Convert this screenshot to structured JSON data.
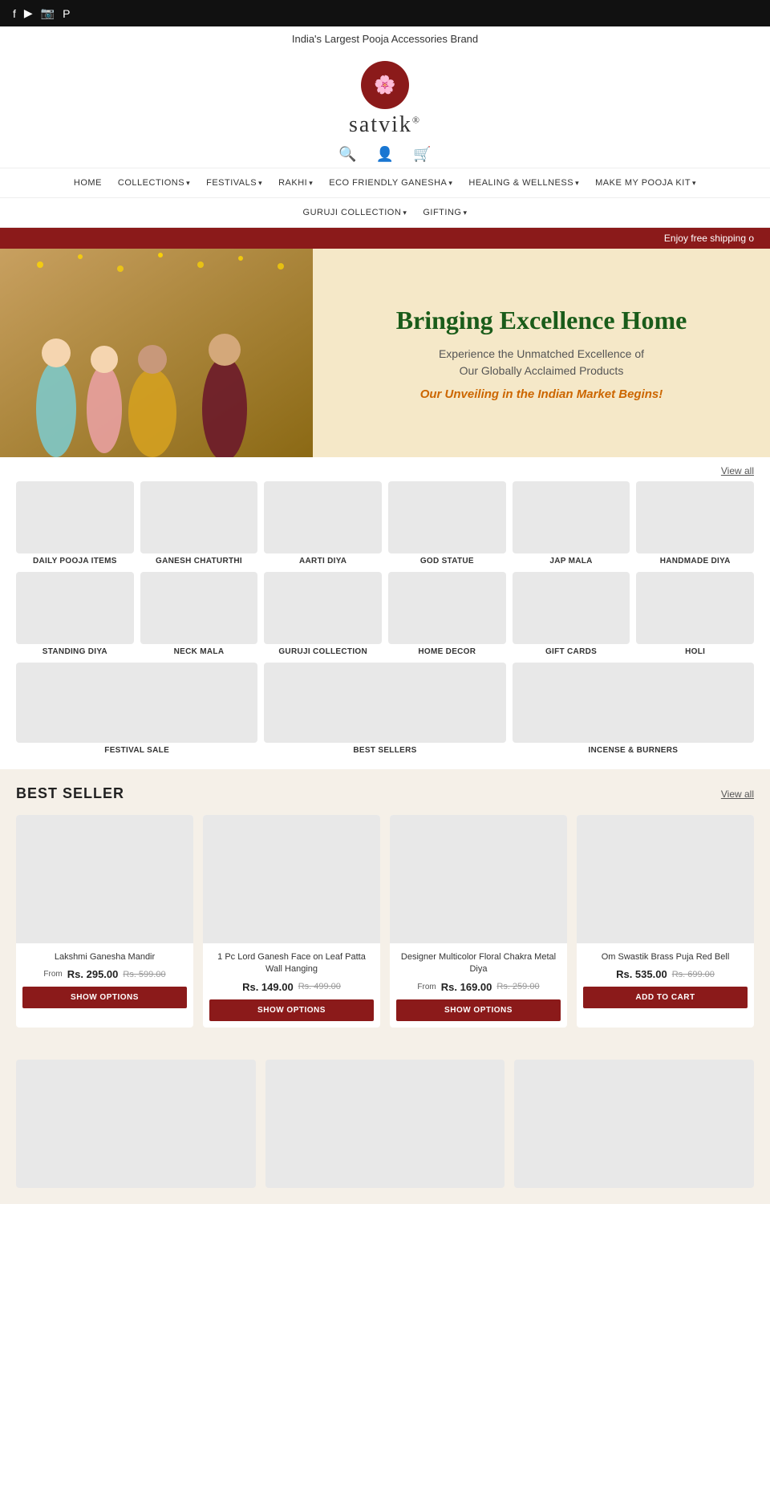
{
  "topbar": {
    "icons": [
      "facebook",
      "youtube",
      "instagram",
      "pinterest"
    ]
  },
  "announcement": {
    "text": "India's Largest Pooja Accessories Brand"
  },
  "logo": {
    "symbol": "🌸",
    "name": "satvik",
    "reg": "®"
  },
  "utility": {
    "search_icon": "🔍",
    "account_icon": "👤",
    "cart_icon": "🛒"
  },
  "nav": {
    "items": [
      {
        "label": "HOME",
        "hasDropdown": false
      },
      {
        "label": "COLLECTIONS",
        "hasDropdown": true
      },
      {
        "label": "FESTIVALS",
        "hasDropdown": true
      },
      {
        "label": "RAKHI",
        "hasDropdown": true
      },
      {
        "label": "ECO FRIENDLY GANESHA",
        "hasDropdown": true
      },
      {
        "label": "HEALING & WELLNESS",
        "hasDropdown": true
      },
      {
        "label": "MAKE MY POOJA KIT",
        "hasDropdown": true
      }
    ],
    "items2": [
      {
        "label": "GURUJI COLLECTION",
        "hasDropdown": true
      },
      {
        "label": "GIFTING",
        "hasDropdown": true
      }
    ]
  },
  "promo": {
    "text": "Enjoy free shipping o"
  },
  "hero": {
    "heading": "Bringing Excellence Home",
    "subtext": "Experience the Unmatched Excellence of\nOur Globally Acclaimed Products",
    "tagline": "Our Unveiling in the Indian Market Begins!"
  },
  "collections": {
    "view_all": "View all",
    "row1": [
      {
        "label": "DAILY POOJA ITEMS"
      },
      {
        "label": "Ganesh Chaturthi"
      },
      {
        "label": "AARTI DIYA"
      },
      {
        "label": "GOD STATUE"
      },
      {
        "label": "JAP MALA"
      },
      {
        "label": "HANDMADE DIYA"
      }
    ],
    "row2": [
      {
        "label": "STANDING DIYA"
      },
      {
        "label": "Neck Mala"
      },
      {
        "label": "GURUJI COLLECTION"
      },
      {
        "label": "HOME DECOR"
      },
      {
        "label": "GIFT CARDS"
      },
      {
        "label": "HOLI"
      }
    ],
    "row3": [
      {
        "label": "FESTIVAL SALE"
      },
      {
        "label": "BEST SELLERS"
      },
      {
        "label": "INCENSE & BURNERS"
      }
    ]
  },
  "best_seller": {
    "title": "BEST SELLER",
    "view_all": "View all",
    "products": [
      {
        "name": "Lakshmi Ganesha Mandir",
        "price_prefix": "From",
        "price": "Rs. 295.00",
        "original": "Rs. 599.00",
        "button": "SHOW OPTIONS",
        "button_type": "show"
      },
      {
        "name": "1 Pc Lord Ganesh Face on Leaf Patta Wall Hanging",
        "price_prefix": "",
        "price": "Rs. 149.00",
        "original": "Rs. 499.00",
        "button": "SHOW OPTIONS",
        "button_type": "show"
      },
      {
        "name": "Designer Multicolor Floral Chakra Metal Diya",
        "price_prefix": "From",
        "price": "Rs. 169.00",
        "original": "Rs. 259.00",
        "button": "SHOW OPTIONS",
        "button_type": "show"
      },
      {
        "name": "Om Swastik Brass Puja Red Bell",
        "price_prefix": "",
        "price": "Rs. 535.00",
        "original": "Rs. 699.00",
        "button": "ADD TO CART",
        "button_type": "add"
      }
    ]
  },
  "bottom_products": [
    {
      "name": ""
    },
    {
      "name": ""
    },
    {
      "name": ""
    }
  ]
}
